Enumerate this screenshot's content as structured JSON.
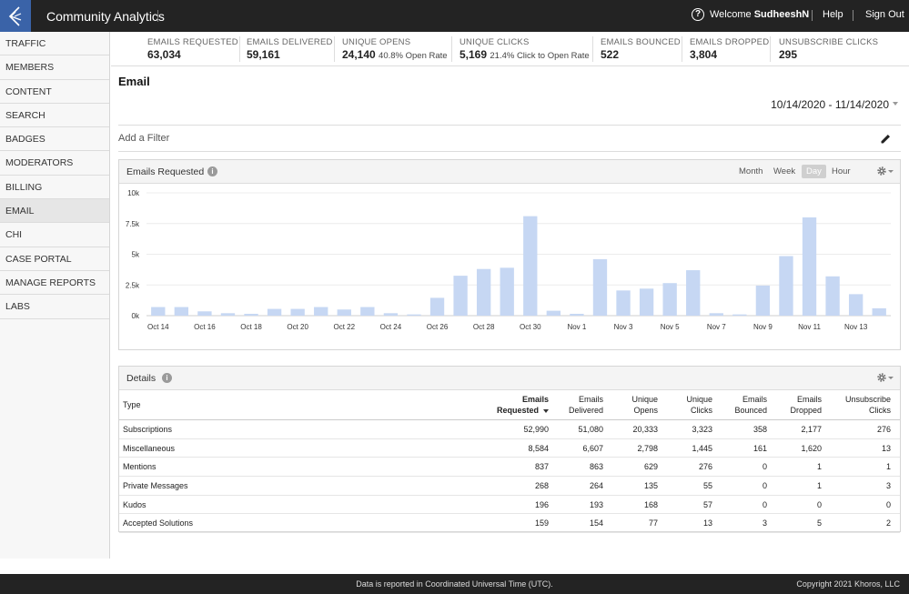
{
  "app": {
    "title": "Community Analytics"
  },
  "header": {
    "welcome_prefix": "Welcome",
    "username": "SudheeshN",
    "help_label": "Help",
    "signout_label": "Sign Out"
  },
  "sidebar": {
    "items": [
      {
        "label": "TRAFFIC"
      },
      {
        "label": "MEMBERS"
      },
      {
        "label": "CONTENT"
      },
      {
        "label": "SEARCH"
      },
      {
        "label": "BADGES"
      },
      {
        "label": "MODERATORS"
      },
      {
        "label": "BILLING"
      },
      {
        "label": "EMAIL",
        "active": true
      },
      {
        "label": "CHI"
      },
      {
        "label": "CASE PORTAL"
      },
      {
        "label": "MANAGE REPORTS"
      },
      {
        "label": "LABS"
      }
    ]
  },
  "stats": [
    {
      "label": "EMAILS REQUESTED",
      "value": "63,034",
      "sub": ""
    },
    {
      "label": "EMAILS DELIVERED",
      "value": "59,161",
      "sub": ""
    },
    {
      "label": "UNIQUE OPENS",
      "value": "24,140",
      "sub": "40.8% Open Rate"
    },
    {
      "label": "UNIQUE CLICKS",
      "value": "5,169",
      "sub": "21.4% Click to Open Rate"
    },
    {
      "label": "EMAILS BOUNCED",
      "value": "522",
      "sub": ""
    },
    {
      "label": "EMAILS DROPPED",
      "value": "3,804",
      "sub": ""
    },
    {
      "label": "UNSUBSCRIBE CLICKS",
      "value": "295",
      "sub": ""
    }
  ],
  "page": {
    "title": "Email",
    "date_range": "10/14/2020 - 11/14/2020",
    "filter_placeholder": "Add a Filter"
  },
  "chart_panel": {
    "title": "Emails Requested",
    "granularity": [
      "Month",
      "Week",
      "Day",
      "Hour"
    ],
    "active_granularity": "Day"
  },
  "chart_data": {
    "type": "bar",
    "categories": [
      "Oct 14",
      "Oct 15",
      "Oct 16",
      "Oct 17",
      "Oct 18",
      "Oct 19",
      "Oct 20",
      "Oct 21",
      "Oct 22",
      "Oct 23",
      "Oct 24",
      "Oct 25",
      "Oct 26",
      "Oct 27",
      "Oct 28",
      "Oct 29",
      "Oct 30",
      "Oct 31",
      "Nov 1",
      "Nov 2",
      "Nov 3",
      "Nov 4",
      "Nov 5",
      "Nov 6",
      "Nov 7",
      "Nov 8",
      "Nov 9",
      "Nov 10",
      "Nov 11",
      "Nov 12",
      "Nov 13",
      "Nov 14"
    ],
    "values": [
      700,
      700,
      350,
      200,
      150,
      550,
      550,
      700,
      500,
      700,
      200,
      100,
      1450,
      3250,
      3800,
      3900,
      8100,
      400,
      150,
      4600,
      2050,
      2200,
      2650,
      3700,
      200,
      100,
      2450,
      4850,
      8000,
      3200,
      1750,
      600
    ],
    "x_tick_labels": [
      "Oct 14",
      "Oct 16",
      "Oct 18",
      "Oct 20",
      "Oct 22",
      "Oct 24",
      "Oct 26",
      "Oct 28",
      "Oct 30",
      "Nov 1",
      "Nov 3",
      "Nov 5",
      "Nov 7",
      "Nov 9",
      "Nov 11",
      "Nov 13"
    ],
    "y_tick_labels": [
      "0k",
      "2.5k",
      "5k",
      "7.5k",
      "10k"
    ],
    "ylim": [
      0,
      10000
    ],
    "color": "#c6d7f3",
    "grid": true
  },
  "details_panel": {
    "title": "Details",
    "columns": [
      {
        "line1": "Type",
        "line2": ""
      },
      {
        "line1": "Emails",
        "line2": "Requested"
      },
      {
        "line1": "Emails",
        "line2": "Delivered"
      },
      {
        "line1": "Unique",
        "line2": "Opens"
      },
      {
        "line1": "Unique",
        "line2": "Clicks"
      },
      {
        "line1": "Emails",
        "line2": "Bounced"
      },
      {
        "line1": "Emails",
        "line2": "Dropped"
      },
      {
        "line1": "Unsubscribe",
        "line2": "Clicks"
      }
    ],
    "rows": [
      [
        "Subscriptions",
        "52,990",
        "51,080",
        "20,333",
        "3,323",
        "358",
        "2,177",
        "276"
      ],
      [
        "Miscellaneous",
        "8,584",
        "6,607",
        "2,798",
        "1,445",
        "161",
        "1,620",
        "13"
      ],
      [
        "Mentions",
        "837",
        "863",
        "629",
        "276",
        "0",
        "1",
        "1"
      ],
      [
        "Private Messages",
        "268",
        "264",
        "135",
        "55",
        "0",
        "1",
        "3"
      ],
      [
        "Kudos",
        "196",
        "193",
        "168",
        "57",
        "0",
        "0",
        "0"
      ],
      [
        "Accepted Solutions",
        "159",
        "154",
        "77",
        "13",
        "3",
        "5",
        "2"
      ]
    ]
  },
  "footer": {
    "center_text": "Data is reported in Coordinated Universal Time (UTC).",
    "copyright": "Copyright 2021 Khoros, LLC"
  }
}
